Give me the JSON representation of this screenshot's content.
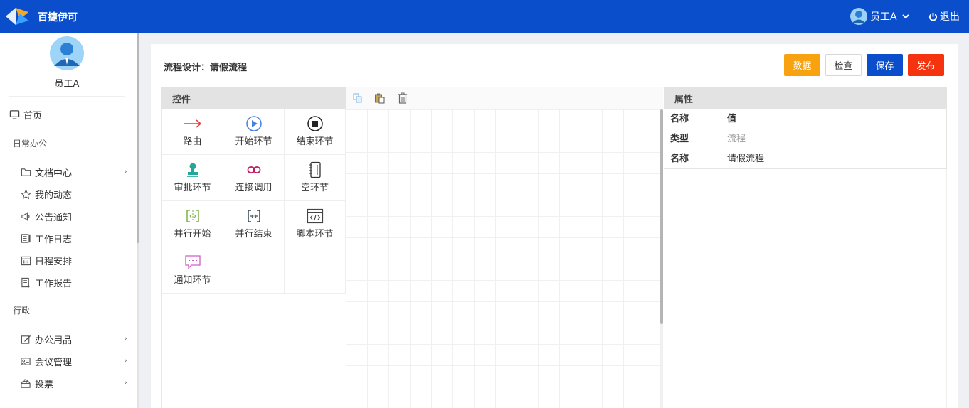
{
  "header": {
    "brand": "百捷伊可",
    "user_name": "员工A",
    "logout_label": "退出"
  },
  "sidebar": {
    "user_name": "员工A",
    "home": "首页",
    "sections": [
      {
        "title": "日常办公",
        "items": [
          {
            "label": "文档中心"
          },
          {
            "label": "我的动态"
          },
          {
            "label": "公告通知"
          },
          {
            "label": "工作日志"
          },
          {
            "label": "日程安排"
          },
          {
            "label": "工作报告"
          }
        ]
      },
      {
        "title": "行政",
        "items": [
          {
            "label": "办公用品"
          },
          {
            "label": "会议管理"
          },
          {
            "label": "投票"
          }
        ]
      }
    ]
  },
  "page": {
    "title": "流程设计：请假流程",
    "buttons": {
      "data": "数据",
      "check": "检查",
      "save": "保存",
      "publish": "发布"
    },
    "colors": {
      "data": "#f7a20e",
      "save": "#0b4ecb",
      "publish": "#f5330f",
      "header": "#0b4ecb"
    }
  },
  "controls": {
    "header": "控件",
    "items": [
      {
        "label": "路由",
        "icon": "arrow-right-icon"
      },
      {
        "label": "开始环节",
        "icon": "play-circle-icon"
      },
      {
        "label": "结束环节",
        "icon": "stop-circle-icon"
      },
      {
        "label": "审批环节",
        "icon": "stamp-icon"
      },
      {
        "label": "连接调用",
        "icon": "link-icon"
      },
      {
        "label": "空环节",
        "icon": "notebook-icon"
      },
      {
        "label": "并行开始",
        "icon": "parallel-start-icon"
      },
      {
        "label": "并行结束",
        "icon": "parallel-end-icon"
      },
      {
        "label": "脚本环节",
        "icon": "code-icon"
      },
      {
        "label": "通知环节",
        "icon": "message-icon"
      }
    ]
  },
  "properties": {
    "header": "属性",
    "col_name": "名称",
    "col_value": "值",
    "rows": [
      {
        "key": "类型",
        "value": "流程"
      },
      {
        "key": "名称",
        "value": "请假流程"
      }
    ]
  }
}
